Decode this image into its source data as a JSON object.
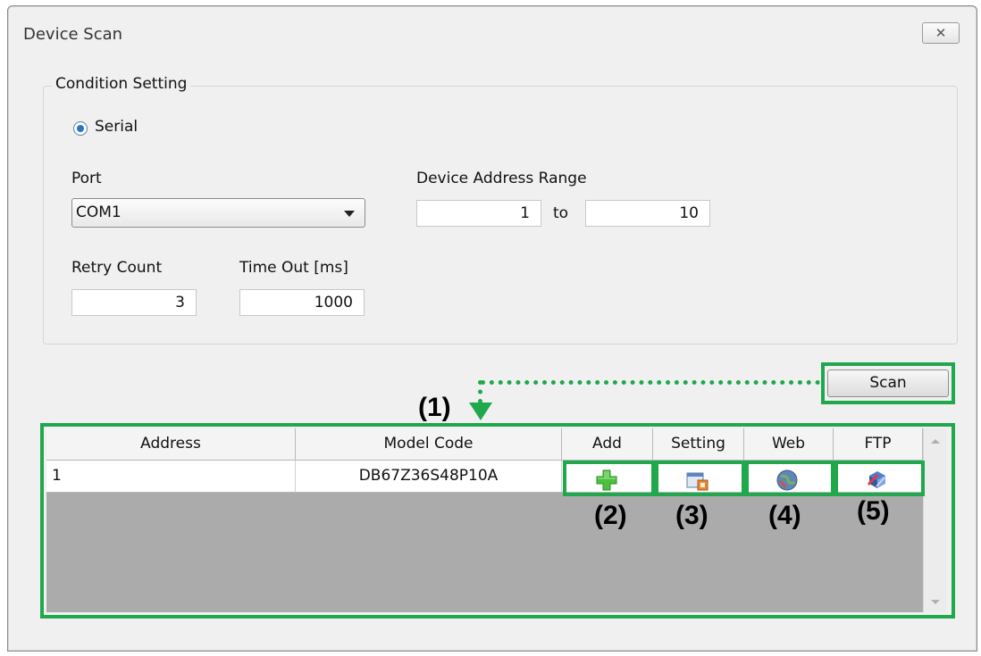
{
  "window": {
    "title": "Device Scan",
    "close_glyph": "✕"
  },
  "condition": {
    "legend": "Condition Setting",
    "radio_label": "Serial",
    "port_label": "Port",
    "port_value": "COM1",
    "range_label": "Device Address Range",
    "range_from": "1",
    "range_to_word": "to",
    "range_to": "10",
    "retry_label": "Retry Count",
    "retry_value": "3",
    "timeout_label": "Time Out [ms]",
    "timeout_value": "1000"
  },
  "scan_label": "Scan",
  "table": {
    "headers": [
      "Address",
      "Model Code",
      "Add",
      "Setting",
      "Web",
      "FTP"
    ],
    "rows": [
      {
        "address": "1",
        "model_code": "DB67Z36S48P10A"
      }
    ]
  },
  "callouts": [
    "(1)",
    "(2)",
    "(3)",
    "(4)",
    "(5)"
  ],
  "icons": {
    "add": "plus-icon",
    "setting": "device-setting-icon",
    "web": "globe-icon",
    "ftp": "ftp-icon"
  },
  "colors": {
    "highlight": "#1fa84c",
    "grid_bg": "#ababab"
  }
}
